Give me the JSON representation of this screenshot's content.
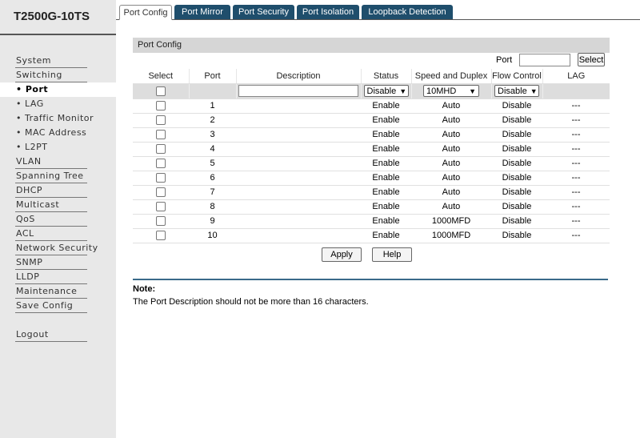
{
  "app": {
    "title": "T2500G-10TS"
  },
  "sidebar": {
    "items": [
      {
        "label": "System",
        "type": "main"
      },
      {
        "label": "Switching",
        "type": "main"
      },
      {
        "label": "• Port",
        "type": "sub",
        "active": true
      },
      {
        "label": "• LAG",
        "type": "sub"
      },
      {
        "label": "• Traffic Monitor",
        "type": "sub"
      },
      {
        "label": "• MAC Address",
        "type": "sub"
      },
      {
        "label": "• L2PT",
        "type": "sub"
      },
      {
        "label": "VLAN",
        "type": "main"
      },
      {
        "label": "Spanning Tree",
        "type": "main"
      },
      {
        "label": "DHCP",
        "type": "main"
      },
      {
        "label": "Multicast",
        "type": "main"
      },
      {
        "label": "QoS",
        "type": "main"
      },
      {
        "label": "ACL",
        "type": "main"
      },
      {
        "label": "Network Security",
        "type": "main"
      },
      {
        "label": "SNMP",
        "type": "main"
      },
      {
        "label": "LLDP",
        "type": "main"
      },
      {
        "label": "Maintenance",
        "type": "main"
      },
      {
        "label": "Save Config",
        "type": "main"
      }
    ],
    "logout": "Logout"
  },
  "tabs": [
    {
      "label": "Port Config",
      "active": true
    },
    {
      "label": "Port Mirror"
    },
    {
      "label": "Port Security"
    },
    {
      "label": "Port Isolation"
    },
    {
      "label": "Loopback Detection"
    }
  ],
  "panel": {
    "title": "Port Config",
    "search": {
      "label": "Port",
      "value": "",
      "button": "Select"
    },
    "columns": [
      "Select",
      "Port",
      "Description",
      "Status",
      "Speed and Duplex",
      "Flow Control",
      "LAG"
    ],
    "edit_row": {
      "description": "",
      "status": "Disable",
      "speed": "10MHD",
      "flow": "Disable"
    },
    "rows": [
      {
        "port": "1",
        "description": "",
        "status": "Enable",
        "speed": "Auto",
        "flow": "Disable",
        "lag": "---"
      },
      {
        "port": "2",
        "description": "",
        "status": "Enable",
        "speed": "Auto",
        "flow": "Disable",
        "lag": "---"
      },
      {
        "port": "3",
        "description": "",
        "status": "Enable",
        "speed": "Auto",
        "flow": "Disable",
        "lag": "---"
      },
      {
        "port": "4",
        "description": "",
        "status": "Enable",
        "speed": "Auto",
        "flow": "Disable",
        "lag": "---"
      },
      {
        "port": "5",
        "description": "",
        "status": "Enable",
        "speed": "Auto",
        "flow": "Disable",
        "lag": "---"
      },
      {
        "port": "6",
        "description": "",
        "status": "Enable",
        "speed": "Auto",
        "flow": "Disable",
        "lag": "---"
      },
      {
        "port": "7",
        "description": "",
        "status": "Enable",
        "speed": "Auto",
        "flow": "Disable",
        "lag": "---"
      },
      {
        "port": "8",
        "description": "",
        "status": "Enable",
        "speed": "Auto",
        "flow": "Disable",
        "lag": "---"
      },
      {
        "port": "9",
        "description": "",
        "status": "Enable",
        "speed": "1000MFD",
        "flow": "Disable",
        "lag": "---"
      },
      {
        "port": "10",
        "description": "",
        "status": "Enable",
        "speed": "1000MFD",
        "flow": "Disable",
        "lag": "---"
      }
    ],
    "apply_button": "Apply",
    "help_button": "Help"
  },
  "note": {
    "title": "Note:",
    "text": "The Port Description should not be more than 16 characters."
  },
  "colors": {
    "tab_bg": "#1f4e6c",
    "note_rule": "#3a6a8a",
    "sidebar_bg": "#e8e8e8"
  }
}
